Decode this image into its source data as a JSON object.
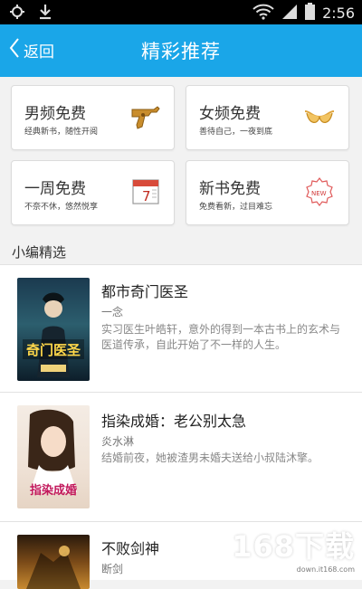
{
  "status": {
    "time": "2:56"
  },
  "header": {
    "back_label": "返回",
    "title": "精彩推荐"
  },
  "categories": [
    {
      "title": "男频免费",
      "subtitle": "经典新书，随性开阅",
      "icon": "gun-icon"
    },
    {
      "title": "女频免费",
      "subtitle": "善待自己，一夜到底",
      "icon": "lingerie-icon"
    },
    {
      "title": "一周免费",
      "subtitle": "不奈不休，悠然悦享",
      "icon": "calendar-icon",
      "icon_text": "7"
    },
    {
      "title": "新书免费",
      "subtitle": "免费看新，过目难忘",
      "icon": "new-badge-icon",
      "icon_text": "NEW"
    }
  ],
  "section_title": "小编精选",
  "books": [
    {
      "title": "都市奇门医圣",
      "author": "一念",
      "desc": "实习医生叶皓轩，意外的得到一本古书上的玄术与医道传承，自此开始了不一样的人生。",
      "cover_text": "奇门医圣"
    },
    {
      "title": "指染成婚：老公别太急",
      "author": "炎水淋",
      "desc": "结婚前夜，她被渣男未婚夫送给小叔陆沐擎。",
      "cover_text": "指染成婚"
    },
    {
      "title": "不败剑神",
      "author": "断剑",
      "desc": "",
      "cover_text": ""
    }
  ],
  "watermark": {
    "text": "168下载",
    "url_text": "down.it168.com"
  }
}
